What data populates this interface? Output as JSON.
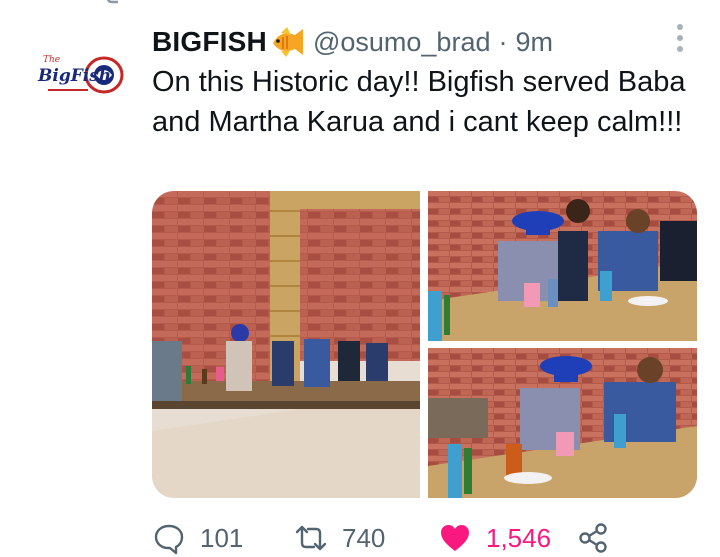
{
  "tweet": {
    "display_name": "BIGFISH",
    "handle": "@osumo_brad",
    "separator": "·",
    "time": "9m",
    "text": "On this Historic day!! Bigfish served Baba and Martha Karua and i cant keep calm!!!",
    "avatar_text": "The BigFish",
    "media_count": 3
  },
  "actions": {
    "replies": "101",
    "retweets": "740",
    "likes": "1,546"
  },
  "icons": {
    "reply": "comment-icon",
    "retweet": "retweet-icon",
    "like": "heart-filled-icon",
    "share": "share-icon",
    "more": "more-vertical-icon",
    "name_emoji": "tropical-fish-emoji"
  },
  "colors": {
    "text": "#0f1419",
    "secondary": "#536471",
    "like": "#f91880",
    "brick": "#b04a3e"
  }
}
